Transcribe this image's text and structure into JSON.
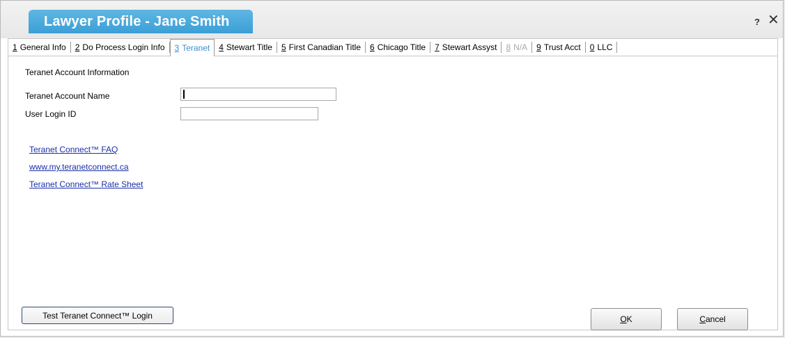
{
  "dialog": {
    "title": "Lawyer Profile - Jane Smith",
    "help_glyph": "?",
    "close_glyph": "✕"
  },
  "tabs": [
    {
      "num": "1",
      "label": "General Info",
      "state": "normal"
    },
    {
      "num": "2",
      "label": "Do Process Login Info",
      "state": "normal"
    },
    {
      "num": "3",
      "label": "Teranet",
      "state": "active"
    },
    {
      "num": "4",
      "label": "Stewart Title",
      "state": "normal"
    },
    {
      "num": "5",
      "label": "First Canadian Title",
      "state": "normal"
    },
    {
      "num": "6",
      "label": "Chicago Title",
      "state": "normal"
    },
    {
      "num": "7",
      "label": "Stewart Assyst",
      "state": "normal"
    },
    {
      "num": "8",
      "label": "N/A",
      "state": "disabled"
    },
    {
      "num": "9",
      "label": "Trust Acct",
      "state": "normal"
    },
    {
      "num": "0",
      "label": "LLC",
      "state": "normal"
    }
  ],
  "form": {
    "section_title": "Teranet Account Information",
    "account_name_label": "Teranet Account Name",
    "account_name_value": "",
    "login_id_label": "User Login ID",
    "login_id_value": ""
  },
  "links": {
    "faq": "Teranet Connect™ FAQ",
    "website": "www.my.teranetconnect.ca",
    "rate_sheet": "Teranet Connect™ Rate Sheet"
  },
  "buttons": {
    "test_login": "Test Teranet Connect™ Login",
    "ok_mnemonic": "O",
    "ok_rest": "K",
    "cancel_mnemonic": "C",
    "cancel_rest": "ancel"
  },
  "colors": {
    "title_tab": "#3b9fd6",
    "active_tab_text": "#3a8fd0",
    "link": "#1a2fa8"
  }
}
